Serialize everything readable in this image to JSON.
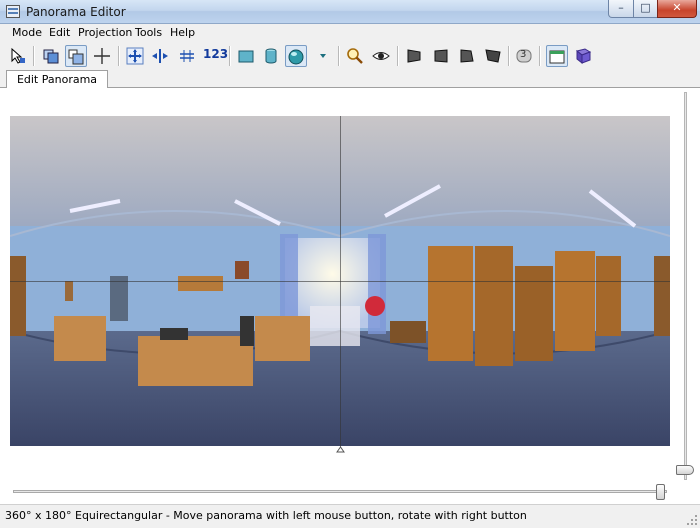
{
  "window": {
    "title": "Panorama Editor",
    "minimize": "–",
    "maximize": "□",
    "close": "✕"
  },
  "menu": [
    "Mode",
    "Edit",
    "Projection",
    "Tools",
    "Help"
  ],
  "toolbar": {
    "icons": [
      "select-pointer-icon",
      "layers-icon",
      "overlay-icon",
      "crosshair-icon",
      "move-all-icon",
      "move-horizontal-icon",
      "move-vertical-icon",
      "numeric-transform-icon",
      "rectilinear-projection-icon",
      "cylindrical-projection-icon",
      "equirectangular-projection-icon",
      "dropdown-arrow-icon",
      "zoom-icon",
      "preview-eye-icon",
      "perspective-left-icon",
      "perspective-center-icon",
      "perspective-right-icon",
      "perspective-full-icon",
      "number-three-icon",
      "fit-window-icon",
      "help-book-icon"
    ],
    "numeric_label": "123",
    "badge_label": "3"
  },
  "tabs": [
    {
      "label": "Edit Panorama"
    }
  ],
  "status": {
    "text": "360° x 180° Equirectangular - Move panorama with left mouse button, rotate with right button"
  },
  "colors": {
    "accent": "#3e7fb8",
    "wall": "#8fb0d8",
    "floor": "#4a5677"
  }
}
